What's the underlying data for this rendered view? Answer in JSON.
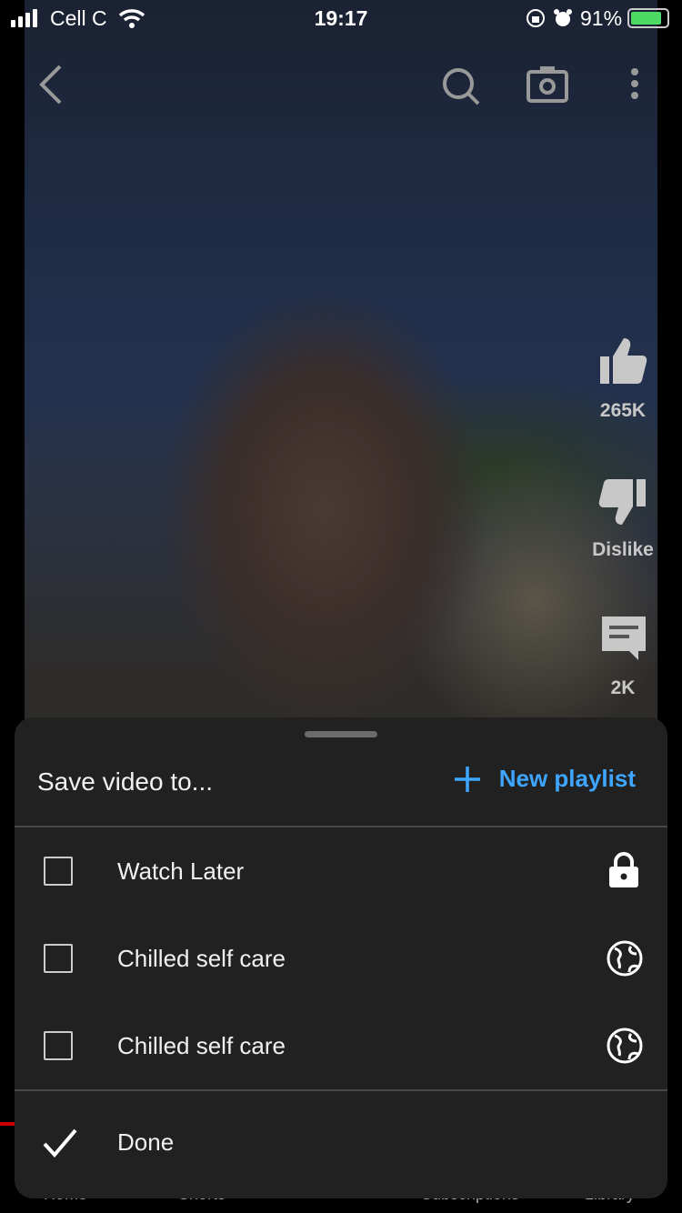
{
  "status_bar": {
    "carrier": "Cell C",
    "time": "19:17",
    "battery": "91%",
    "battery_level": 0.91
  },
  "video": {
    "likes": "265K",
    "dislike_label": "Dislike",
    "comments": "2K"
  },
  "bottom_nav": [
    "Home",
    "Shorts",
    "Subscriptions",
    "Library"
  ],
  "sheet": {
    "title": "Save video to...",
    "new_playlist": "New playlist",
    "playlists": [
      {
        "name": "Watch Later",
        "checked": false,
        "privacy": "lock-icon"
      },
      {
        "name": "Chilled self care",
        "checked": false,
        "privacy": "globe-icon"
      },
      {
        "name": "Chilled self care",
        "checked": false,
        "privacy": "globe-icon"
      }
    ],
    "done": "Done"
  },
  "colors": {
    "accent": "#3ea6ff",
    "sheet_bg": "#212121"
  }
}
